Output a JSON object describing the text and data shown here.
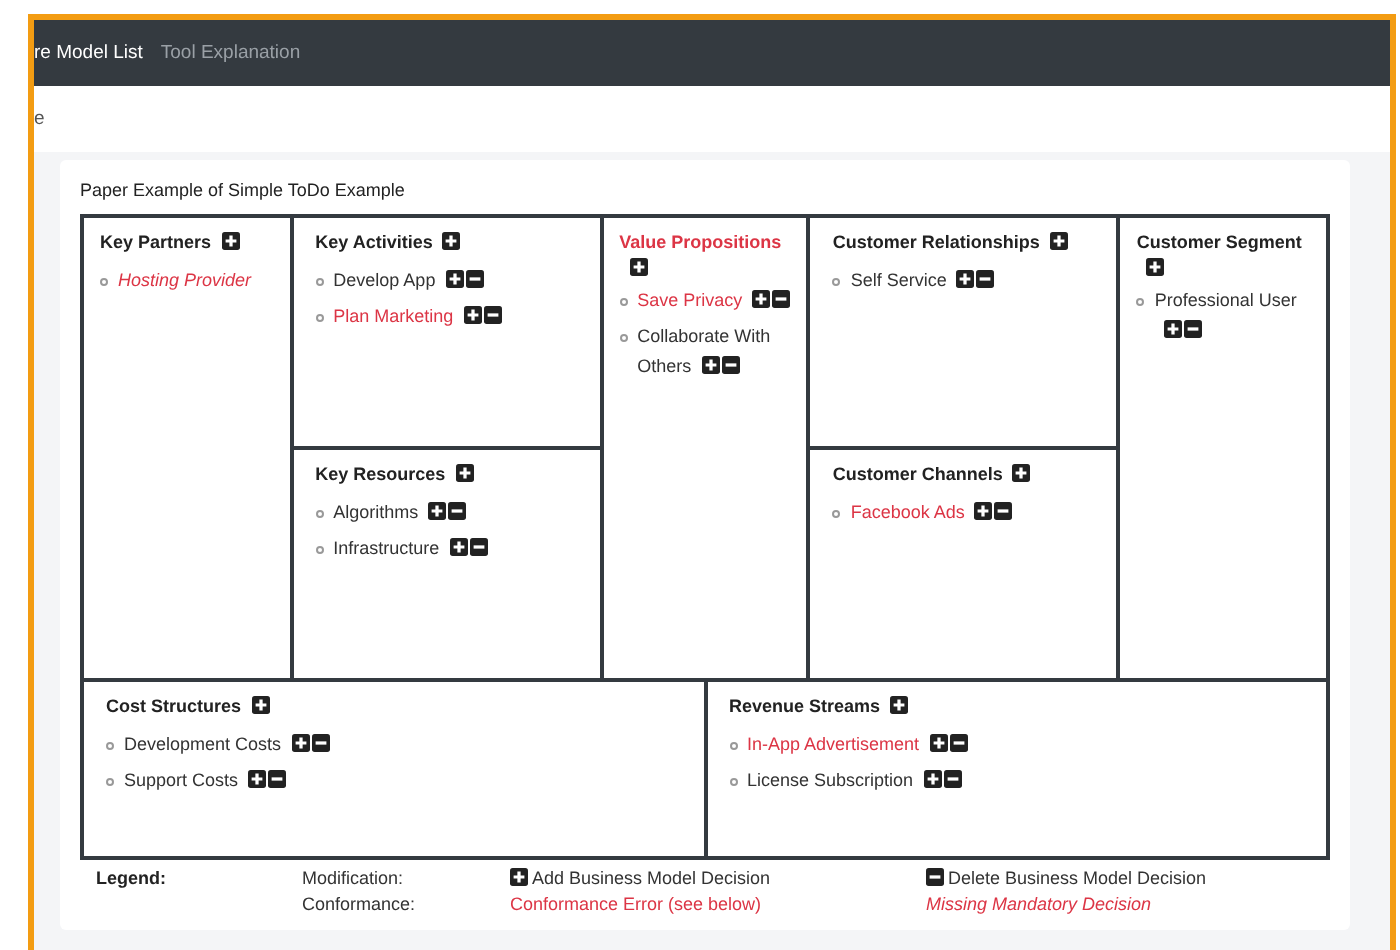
{
  "nav": {
    "items": [
      {
        "label": "re Model List",
        "selected": true
      },
      {
        "label": "Tool Explanation",
        "selected": false
      }
    ]
  },
  "breadcrumb": "e",
  "canvas": {
    "title": "Paper Example of Simple ToDo Example",
    "top": [
      {
        "blocks": [
          {
            "title": "Key Partners",
            "error": false,
            "items": [
              {
                "label": "Hosting Provider",
                "error": true,
                "missing": true
              }
            ]
          }
        ]
      },
      {
        "blocks": [
          {
            "title": "Key Activities",
            "error": false,
            "items": [
              {
                "label": "Develop App",
                "error": false,
                "missing": false
              },
              {
                "label": "Plan Marketing",
                "error": true,
                "missing": false
              }
            ]
          },
          {
            "title": "Key Resources",
            "error": false,
            "items": [
              {
                "label": "Algorithms",
                "error": false,
                "missing": false
              },
              {
                "label": "Infrastructure",
                "error": false,
                "missing": false
              }
            ]
          }
        ]
      },
      {
        "blocks": [
          {
            "title": "Value Propositions",
            "error": true,
            "items": [
              {
                "label": "Save Privacy",
                "error": true,
                "missing": false
              },
              {
                "label": "Collaborate With Others",
                "error": false,
                "missing": false
              }
            ]
          }
        ]
      },
      {
        "blocks": [
          {
            "title": "Customer Relationships",
            "error": false,
            "items": [
              {
                "label": "Self Service",
                "error": false,
                "missing": false
              }
            ]
          },
          {
            "title": "Customer Channels",
            "error": false,
            "items": [
              {
                "label": "Facebook Ads",
                "error": true,
                "missing": false
              }
            ]
          }
        ]
      },
      {
        "blocks": [
          {
            "title": "Customer Segment",
            "error": false,
            "items": [
              {
                "label": "Professional User",
                "error": false,
                "missing": false
              }
            ]
          }
        ]
      }
    ],
    "bottom": [
      {
        "title": "Cost Structures",
        "error": false,
        "items": [
          {
            "label": "Development Costs",
            "error": false,
            "missing": false
          },
          {
            "label": "Support Costs",
            "error": false,
            "missing": false
          }
        ]
      },
      {
        "title": "Revenue Streams",
        "error": false,
        "items": [
          {
            "label": "In-App Advertisement",
            "error": true,
            "missing": false
          },
          {
            "label": "License Subscription",
            "error": false,
            "missing": false
          }
        ]
      }
    ]
  },
  "legend": {
    "label": "Legend:",
    "rows": [
      {
        "label": "Modification:",
        "entries": [
          {
            "kind": "add",
            "text": "Add Business Model Decision"
          },
          {
            "kind": "delete",
            "text": "Delete Business Model Decision"
          }
        ]
      },
      {
        "label": "Conformance:",
        "entries": [
          {
            "kind": "error",
            "text": "Conformance Error (see below)"
          },
          {
            "kind": "missing",
            "text": "Missing Mandatory Decision"
          }
        ]
      }
    ]
  }
}
